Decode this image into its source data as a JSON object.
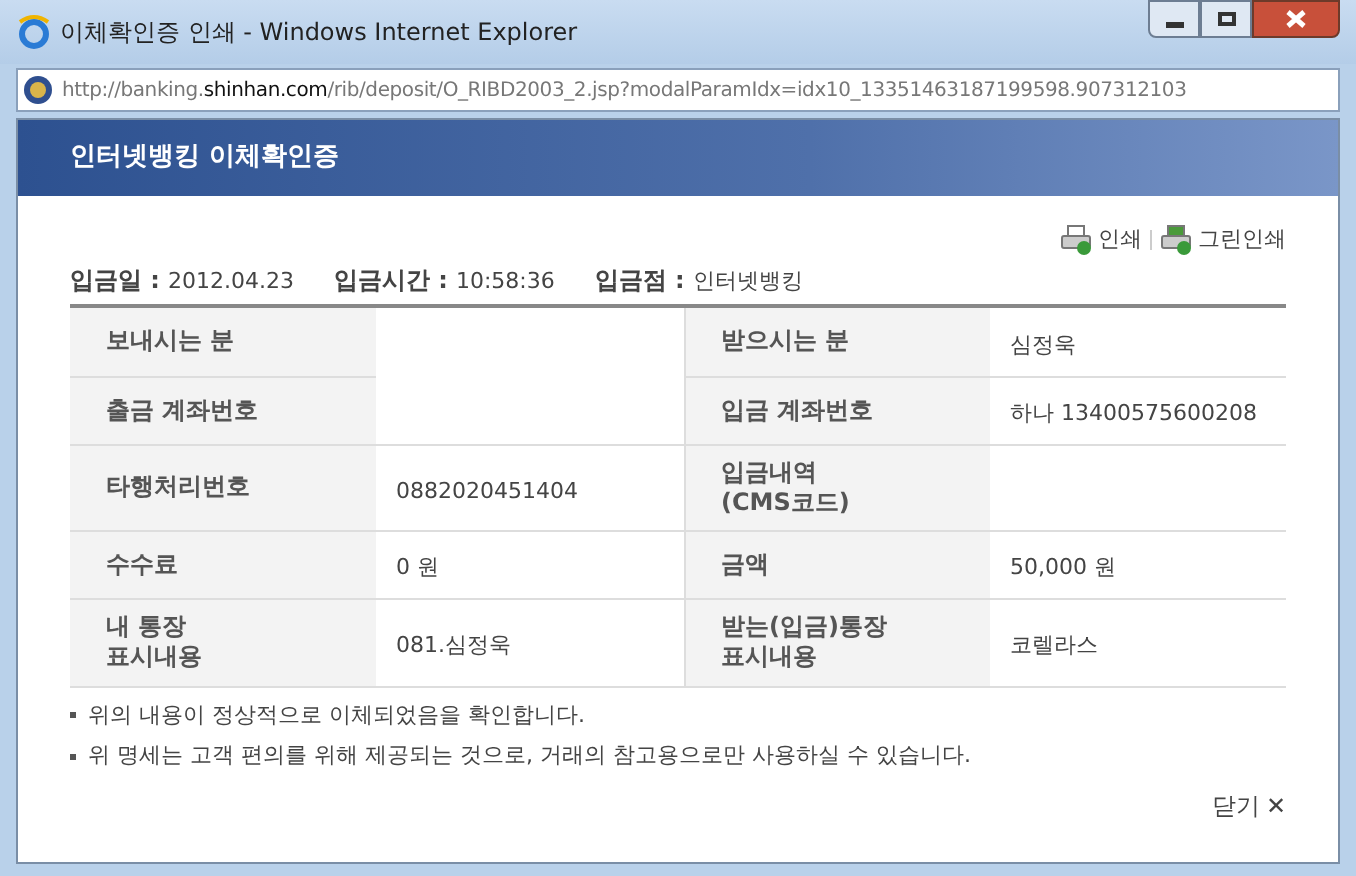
{
  "window": {
    "title": "이체확인증 인쇄 - Windows Internet Explorer"
  },
  "address": {
    "prefix": "http://banking.",
    "domain": "shinhan.com",
    "path": "/rib/deposit/O_RIBD2003_2.jsp?modalParamIdx=idx10_13351463187199598.907312103"
  },
  "header": {
    "title": "인터넷뱅킹 이체확인증"
  },
  "actions": [
    {
      "label": "인쇄"
    },
    {
      "label": "그린인쇄"
    }
  ],
  "summary": [
    {
      "label": "입금일 :",
      "value": "2012.04.23"
    },
    {
      "label": "입금시간 :",
      "value": "10:58:36"
    },
    {
      "label": "입금점 :",
      "value": "인터넷뱅킹"
    }
  ],
  "rows": [
    {
      "left_label": "보내시는 분",
      "right_label": "받으시는 분",
      "right_value": "심정욱"
    },
    {
      "left_label": "출금 계좌번호",
      "right_label": "입금 계좌번호",
      "right_value": "하나 13400575600208"
    },
    {
      "left_label": "타행처리번호",
      "left_value": "0882020451404",
      "right_label": "입금내역\n(CMS코드)"
    },
    {
      "left_label": "수수료",
      "left_value": "0 원",
      "right_label": "금액",
      "right_value": "50,000 원"
    },
    {
      "left_label": "내 통장\n표시내용",
      "left_value": "081.심정욱",
      "right_label": "받는(입금)통장\n표시내용",
      "right_value": "코렐라스"
    }
  ],
  "notes": [
    "위의 내용이 정상적으로 이체되었음을 확인합니다.",
    "위 명세는 고객 편의를 위해 제공되는 것으로, 거래의 참고용으로만 사용하실 수 있습니다."
  ],
  "close": {
    "label": "닫기",
    "symbol": "✕"
  }
}
